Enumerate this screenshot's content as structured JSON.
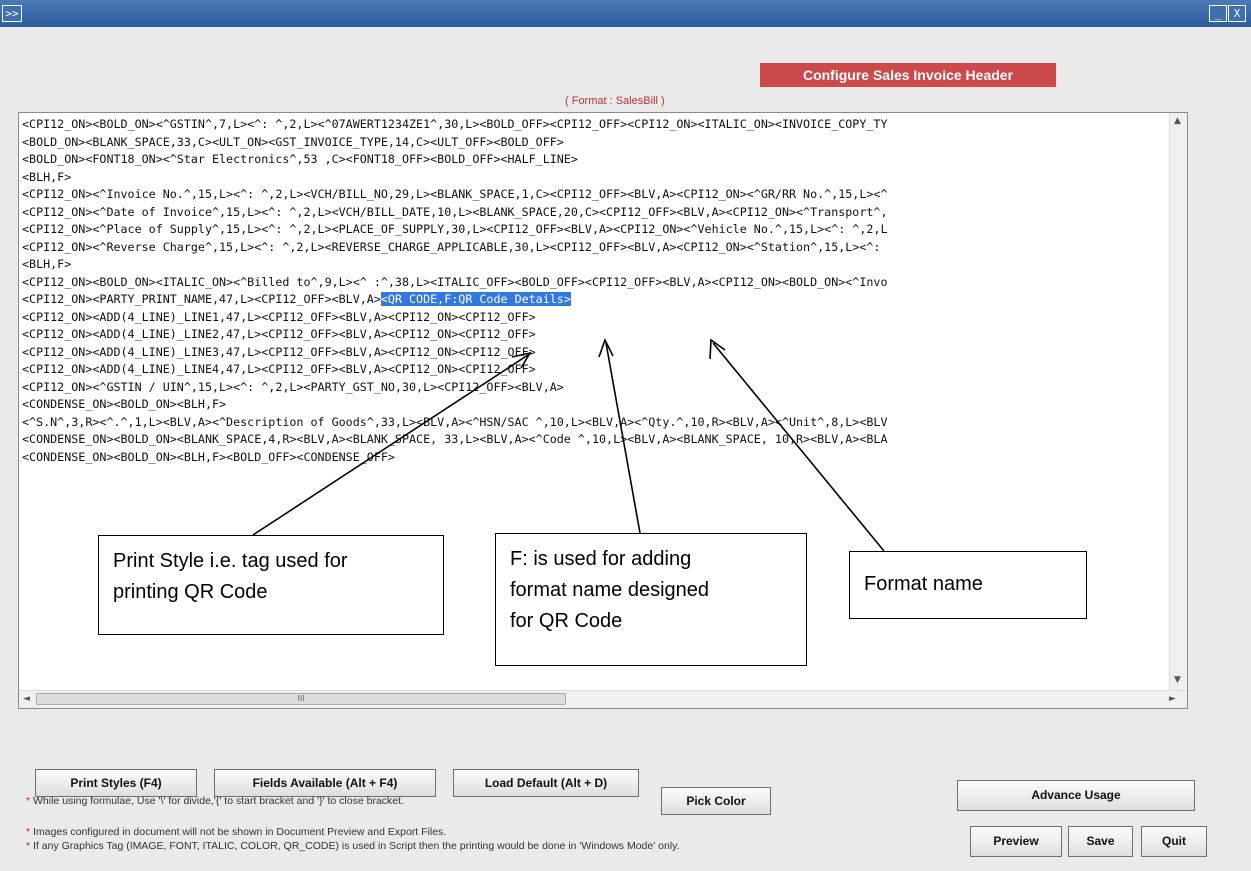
{
  "window": {
    "expand_glyph": ">>",
    "minimize_glyph": "_",
    "close_glyph": "X"
  },
  "header": {
    "title": "Configure Sales Invoice Header",
    "format_label": "( Format : SalesBill )"
  },
  "editor": {
    "lines": [
      "<CPI12_ON><BOLD_ON><^GSTIN^,7,L><^: ^,2,L><^07AWERT1234ZE1^,30,L><BOLD_OFF><CPI12_OFF><CPI12_ON><ITALIC_ON><INVOICE_COPY_TY",
      "<BOLD_ON><BLANK_SPACE,33,C><ULT_ON><GST_INVOICE_TYPE,14,C><ULT_OFF><BOLD_OFF>",
      "<BOLD_ON><FONT18_ON><^Star Electronics^,53 ,C><FONT18_OFF><BOLD_OFF><HALF_LINE>",
      "<BLH,F>",
      "<CPI12_ON><^Invoice No.^,15,L><^: ^,2,L><VCH/BILL_NO,29,L><BLANK_SPACE,1,C><CPI12_OFF><BLV,A><CPI12_ON><^GR/RR No.^,15,L><^",
      "<CPI12_ON><^Date of Invoice^,15,L><^: ^,2,L><VCH/BILL_DATE,10,L><BLANK_SPACE,20,C><CPI12_OFF><BLV,A><CPI12_ON><^Transport^,",
      "<CPI12_ON><^Place of Supply^,15,L><^: ^,2,L><PLACE_OF_SUPPLY,30,L><CPI12_OFF><BLV,A><CPI12_ON><^Vehicle No.^,15,L><^: ^,2,L",
      "<CPI12_ON><^Reverse Charge^,15,L><^: ^,2,L><REVERSE_CHARGE_APPLICABLE,30,L><CPI12_OFF><BLV,A><CPI12_ON><^Station^,15,L><^: ",
      "<BLH,F>",
      "<CPI12_ON><BOLD_ON><ITALIC_ON><^Billed to^,9,L><^ :^,38,L><ITALIC_OFF><BOLD_OFF><CPI12_OFF><BLV,A><CPI12_ON><BOLD_ON><^Invo",
      "<CPI12_ON><PARTY_PRINT_NAME,47,L><CPI12_OFF><BLV,A>",
      "<CPI12_ON><ADD(4_LINE)_LINE1,47,L><CPI12_OFF><BLV,A><CPI12_ON><CPI12_OFF>",
      "<CPI12_ON><ADD(4_LINE)_LINE2,47,L><CPI12_OFF><BLV,A><CPI12_ON><CPI12_OFF>",
      "<CPI12_ON><ADD(4_LINE)_LINE3,47,L><CPI12_OFF><BLV,A><CPI12_ON><CPI12_OFF>",
      "<CPI12_ON><ADD(4_LINE)_LINE4,47,L><CPI12_OFF><BLV,A><CPI12_ON><CPI12_OFF>",
      "<CPI12_ON><^GSTIN / UIN^,15,L><^: ^,2,L><PARTY_GST_NO,30,L><CPI12_OFF><BLV,A>",
      "<CONDENSE_ON><BOLD_ON><BLH,F>",
      "<^S.N^,3,R><^.^,1,L><BLV,A><^Description of Goods^,33,L><BLV,A><^HSN/SAC ^,10,L><BLV,A><^Qty.^,10,R><BLV,A><^Unit^,8,L><BLV",
      "<CONDENSE_ON><BOLD_ON><BLANK_SPACE,4,R><BLV,A><BLANK_SPACE, 33,L><BLV,A><^Code ^,10,L><BLV,A><BLANK_SPACE, 10,R><BLV,A><BLA",
      "<CONDENSE_ON><BOLD_ON><BLH,F><BOLD_OFF><CONDENSE_OFF>"
    ],
    "selected_text": "<QR CODE,F:QR Code Details>",
    "scroll_thumb_label": "III",
    "scroll_left": "◄",
    "scroll_right": "►",
    "scroll_up": "▲",
    "scroll_down": "▼"
  },
  "callouts": {
    "print_style": [
      "Print Style i.e. tag used for",
      "printing QR Code"
    ],
    "f_prefix": [
      "F: is used for adding",
      "format name designed",
      "for QR Code"
    ],
    "format_name": [
      "Format name"
    ]
  },
  "buttons": {
    "print_styles": "Print Styles (F4)",
    "fields_available": "Fields Available (Alt + F4)",
    "load_default": "Load Default (Alt + D)",
    "pick_color": "Pick Color",
    "advance_usage": "Advance Usage",
    "preview": "Preview",
    "save": "Save",
    "quit": "Quit"
  },
  "notes": {
    "formulae": "While using formulae, Use '\\' for divide,'{' to start bracket and '}' to close bracket.",
    "images": "Images configured in document will not be shown in Document Preview and Export Files.",
    "graphics": "If any Graphics Tag (IMAGE, FONT, ITALIC, COLOR, QR_CODE) is used in Script then the printing would be done in 'Windows Mode' only.",
    "star": "*"
  },
  "colors": {
    "title_bar": "#2d5c9a",
    "header_button": "#cc4a4a",
    "selection": "#3377e0"
  }
}
